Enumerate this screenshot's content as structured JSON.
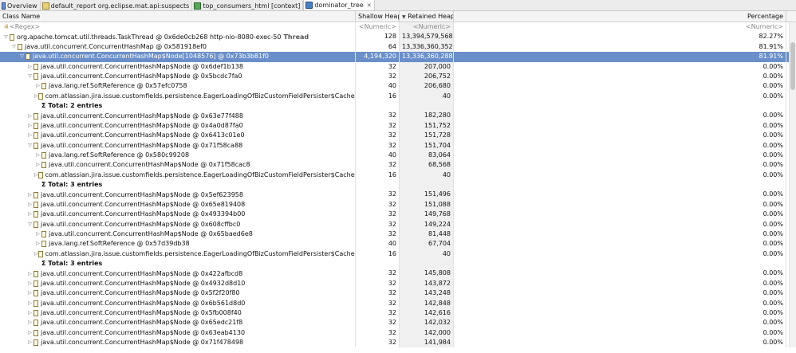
{
  "tabs": [
    {
      "label": "Overview",
      "icon": "overview-icon"
    },
    {
      "label": "default_report  org.eclipse.mat.api:suspects",
      "icon": "report-icon"
    },
    {
      "label": "top_consumers_html [context]",
      "icon": "html-icon"
    },
    {
      "label": "dominator_tree",
      "icon": "tree-icon",
      "active": true,
      "closable": true
    }
  ],
  "columns": {
    "class_name": "Class Name",
    "shallow_heap": "Shallow Heap",
    "retained_heap": "Retained Heap",
    "retained_sort": "desc",
    "percentage": "Percentage"
  },
  "filter_row": {
    "regex": "<Regex>",
    "numeric1": "<Numeric>",
    "numeric2": "<Numeric>",
    "numeric3": "<Numeric>"
  },
  "rows": [
    {
      "indent": 0,
      "twist": "expanded",
      "icon": true,
      "text": "org.apache.tomcat.util.threads.TaskThread @ 0x6de0cb268  http-nio-8080-exec-50",
      "suffix": "Thread",
      "shallow": "128",
      "retained": "13,394,579,568",
      "pct": "82.27%"
    },
    {
      "indent": 1,
      "twist": "expanded",
      "icon": true,
      "text": "java.util.concurrent.ConcurrentHashMap @ 0x581918ef0",
      "shallow": "64",
      "retained": "13,336,360,352",
      "pct": "81.91%"
    },
    {
      "indent": 2,
      "twist": "expanded",
      "icon": true,
      "text": "java.util.concurrent.ConcurrentHashMap$Node[1048576] @ 0x73b3b81f0",
      "shallow": "4,194,320",
      "retained": "13,336,360,288",
      "pct": "81.91%",
      "selected": true
    },
    {
      "indent": 3,
      "twist": "collapsed",
      "icon": true,
      "text": "java.util.concurrent.ConcurrentHashMap$Node @ 0x6def1b138",
      "shallow": "32",
      "retained": "207,000",
      "pct": "0.00%"
    },
    {
      "indent": 3,
      "twist": "expanded",
      "icon": true,
      "text": "java.util.concurrent.ConcurrentHashMap$Node @ 0x5bcdc7fa0",
      "shallow": "32",
      "retained": "206,752",
      "pct": "0.00%"
    },
    {
      "indent": 4,
      "twist": "collapsed",
      "icon": true,
      "text": "java.lang.ref.SoftReference @ 0x57efc0758",
      "shallow": "40",
      "retained": "206,680",
      "pct": "0.00%"
    },
    {
      "indent": 4,
      "twist": "collapsed",
      "icon": true,
      "text": "com.atlassian.jira.issue.customfields.persistence.EagerLoadingOfBizCustomFieldPersister$CacheKey @ 0x",
      "shallow": "16",
      "retained": "40",
      "pct": "0.00%"
    },
    {
      "indent": 4,
      "twist": "none",
      "icon": false,
      "text": "Σ  Total: 2 entries",
      "total": true,
      "shallow": "",
      "retained": "",
      "pct": ""
    },
    {
      "indent": 3,
      "twist": "collapsed",
      "icon": true,
      "text": "java.util.concurrent.ConcurrentHashMap$Node @ 0x63e77f488",
      "shallow": "32",
      "retained": "182,280",
      "pct": "0.00%"
    },
    {
      "indent": 3,
      "twist": "collapsed",
      "icon": true,
      "text": "java.util.concurrent.ConcurrentHashMap$Node @ 0x4a0d87fa0",
      "shallow": "32",
      "retained": "151,752",
      "pct": "0.00%"
    },
    {
      "indent": 3,
      "twist": "collapsed",
      "icon": true,
      "text": "java.util.concurrent.ConcurrentHashMap$Node @ 0x6413c01e0",
      "shallow": "32",
      "retained": "151,728",
      "pct": "0.00%"
    },
    {
      "indent": 3,
      "twist": "expanded",
      "icon": true,
      "text": "java.util.concurrent.ConcurrentHashMap$Node @ 0x71f58ca88",
      "shallow": "32",
      "retained": "151,704",
      "pct": "0.00%"
    },
    {
      "indent": 4,
      "twist": "collapsed",
      "icon": true,
      "text": "java.lang.ref.SoftReference @ 0x580c99208",
      "shallow": "40",
      "retained": "83,064",
      "pct": "0.00%"
    },
    {
      "indent": 4,
      "twist": "collapsed",
      "icon": true,
      "text": "java.util.concurrent.ConcurrentHashMap$Node @ 0x71f58cac8",
      "shallow": "32",
      "retained": "68,568",
      "pct": "0.00%"
    },
    {
      "indent": 4,
      "twist": "collapsed",
      "icon": true,
      "text": "com.atlassian.jira.issue.customfields.persistence.EagerLoadingOfBizCustomFieldPersister$CacheKey @ 0x",
      "shallow": "16",
      "retained": "40",
      "pct": "0.00%"
    },
    {
      "indent": 4,
      "twist": "none",
      "icon": false,
      "text": "Σ  Total: 3 entries",
      "total": true,
      "shallow": "",
      "retained": "",
      "pct": ""
    },
    {
      "indent": 3,
      "twist": "collapsed",
      "icon": true,
      "text": "java.util.concurrent.ConcurrentHashMap$Node @ 0x5ef623958",
      "shallow": "32",
      "retained": "151,496",
      "pct": "0.00%"
    },
    {
      "indent": 3,
      "twist": "collapsed",
      "icon": true,
      "text": "java.util.concurrent.ConcurrentHashMap$Node @ 0x65e819408",
      "shallow": "32",
      "retained": "151,088",
      "pct": "0.00%"
    },
    {
      "indent": 3,
      "twist": "collapsed",
      "icon": true,
      "text": "java.util.concurrent.ConcurrentHashMap$Node @ 0x493394b00",
      "shallow": "32",
      "retained": "149,768",
      "pct": "0.00%"
    },
    {
      "indent": 3,
      "twist": "expanded",
      "icon": true,
      "text": "java.util.concurrent.ConcurrentHashMap$Node @ 0x608cffbc0",
      "shallow": "32",
      "retained": "149,224",
      "pct": "0.00%"
    },
    {
      "indent": 4,
      "twist": "collapsed",
      "icon": true,
      "text": "java.util.concurrent.ConcurrentHashMap$Node @ 0x65baed6e8",
      "shallow": "32",
      "retained": "81,448",
      "pct": "0.00%"
    },
    {
      "indent": 4,
      "twist": "collapsed",
      "icon": true,
      "text": "java.lang.ref.SoftReference @ 0x57d39db38",
      "shallow": "40",
      "retained": "67,704",
      "pct": "0.00%"
    },
    {
      "indent": 4,
      "twist": "collapsed",
      "icon": true,
      "text": "com.atlassian.jira.issue.customfields.persistence.EagerLoadingOfBizCustomFieldPersister$CacheKey @ 0x",
      "shallow": "16",
      "retained": "40",
      "pct": "0.00%"
    },
    {
      "indent": 4,
      "twist": "none",
      "icon": false,
      "text": "Σ  Total: 3 entries",
      "total": true,
      "shallow": "",
      "retained": "",
      "pct": ""
    },
    {
      "indent": 3,
      "twist": "collapsed",
      "icon": true,
      "text": "java.util.concurrent.ConcurrentHashMap$Node @ 0x422afbcd8",
      "shallow": "32",
      "retained": "145,808",
      "pct": "0.00%"
    },
    {
      "indent": 3,
      "twist": "collapsed",
      "icon": true,
      "text": "java.util.concurrent.ConcurrentHashMap$Node @ 0x4932d8d10",
      "shallow": "32",
      "retained": "143,872",
      "pct": "0.00%"
    },
    {
      "indent": 3,
      "twist": "collapsed",
      "icon": true,
      "text": "java.util.concurrent.ConcurrentHashMap$Node @ 0x5f2f20f80",
      "shallow": "32",
      "retained": "143,248",
      "pct": "0.00%"
    },
    {
      "indent": 3,
      "twist": "collapsed",
      "icon": true,
      "text": "java.util.concurrent.ConcurrentHashMap$Node @ 0x6b561d8d0",
      "shallow": "32",
      "retained": "142,848",
      "pct": "0.00%"
    },
    {
      "indent": 3,
      "twist": "collapsed",
      "icon": true,
      "text": "java.util.concurrent.ConcurrentHashMap$Node @ 0x5fb008f40",
      "shallow": "32",
      "retained": "142,616",
      "pct": "0.00%"
    },
    {
      "indent": 3,
      "twist": "collapsed",
      "icon": true,
      "text": "java.util.concurrent.ConcurrentHashMap$Node @ 0x65edc21f8",
      "shallow": "32",
      "retained": "142,032",
      "pct": "0.00%"
    },
    {
      "indent": 3,
      "twist": "collapsed",
      "icon": true,
      "text": "java.util.concurrent.ConcurrentHashMap$Node @ 0x63eab4130",
      "shallow": "32",
      "retained": "142,000",
      "pct": "0.00%"
    },
    {
      "indent": 3,
      "twist": "collapsed",
      "icon": true,
      "text": "java.util.concurrent.ConcurrentHashMap$Node @ 0x71f478498",
      "shallow": "32",
      "retained": "141,984",
      "pct": "0.00%"
    }
  ]
}
